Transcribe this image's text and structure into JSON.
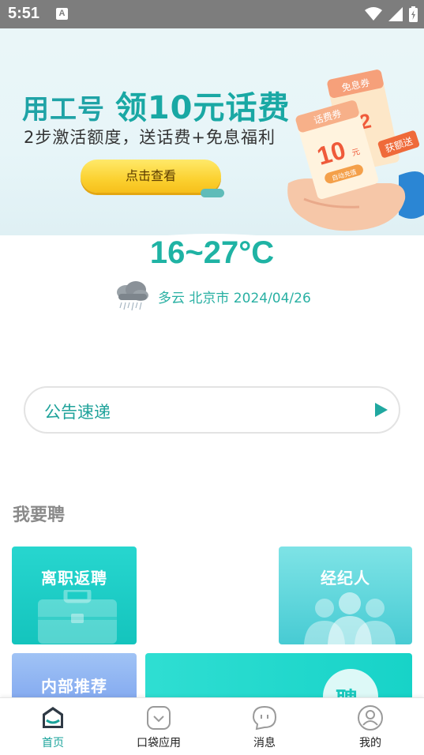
{
  "status_bar": {
    "time": "5:51",
    "notif_icon": "A"
  },
  "banner": {
    "title_part1": "用工号 ",
    "title_part2": "领10元话费",
    "subtitle": "2步激活额度，送话费+免息福利",
    "button_label": "点击查看",
    "ticket_free": "免息券",
    "ticket_phone": "话费券",
    "ticket_12": "12",
    "ticket_10": "10",
    "ticket_yuan": "元",
    "ticket_gift": "获额送",
    "ticket_activate": "自动充值"
  },
  "weather": {
    "temperature": "16~27°C",
    "details": "多云 北京市 2024/04/26"
  },
  "notice": {
    "label": "公告速递"
  },
  "section": {
    "title": "我要聘"
  },
  "cards": {
    "rehire": "离职返聘",
    "agent": "经纪人",
    "referral": "内部推荐",
    "hire_glyph": "聘"
  },
  "tabbar": {
    "items": [
      {
        "label": "首页",
        "icon": "home-icon",
        "active": true
      },
      {
        "label": "口袋应用",
        "icon": "pocket-icon",
        "active": false
      },
      {
        "label": "消息",
        "icon": "message-icon",
        "active": false
      },
      {
        "label": "我的",
        "icon": "profile-icon",
        "active": false
      }
    ]
  },
  "colors": {
    "accent": "#1aa39b",
    "status_bar": "#7d7d7d"
  }
}
